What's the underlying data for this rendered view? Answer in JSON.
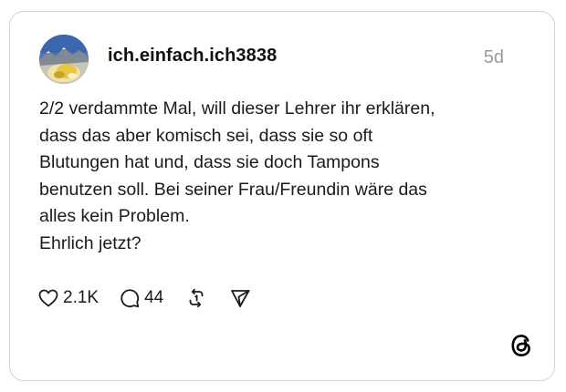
{
  "post": {
    "username": "ich.einfach.ich3838",
    "time": "5d",
    "text_lines": [
      "2/2 verdammte Mal, will dieser Lehrer ihr erklären,",
      "dass das aber komisch sei, dass sie so oft",
      "Blutungen hat und, dass sie doch Tampons",
      "benutzen soll. Bei seiner Frau/Freundin wäre das",
      "alles kein Problem.",
      "Ehrlich jetzt?"
    ],
    "likes": "2.1K",
    "replies": "44"
  },
  "icons": {
    "avatar": "profile-photo",
    "like": "heart-icon",
    "reply": "comment-bubble-icon",
    "repost": "repost-icon",
    "share": "send-icon",
    "brand": "threads-logo"
  },
  "colors": {
    "text": "#1b1b1b",
    "muted": "#999999",
    "border": "#d4d4d4"
  }
}
